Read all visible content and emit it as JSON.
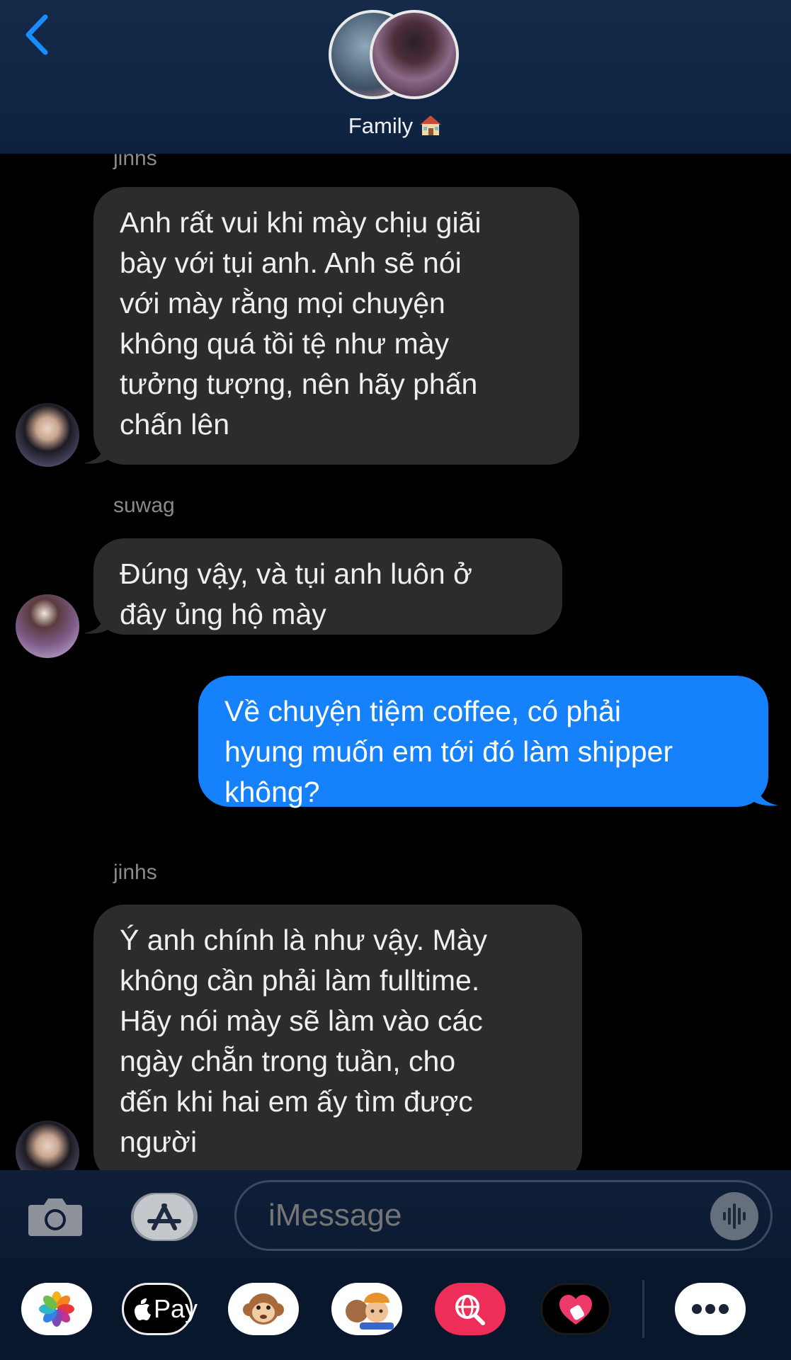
{
  "header": {
    "group_name": "Family",
    "back_icon": "chevron-left-icon",
    "accent_color": "#1a8cff"
  },
  "messages": [
    {
      "sender": "jinhs",
      "direction": "incoming",
      "lines": [
        "Anh rất vui khi mày chịu giãi",
        "bày với tụi anh. Anh sẽ nói",
        "với mày rằng mọi chuyện",
        "không quá tồi tệ như mày",
        "tưởng tượng, nên hãy phấn",
        "chấn lên"
      ]
    },
    {
      "sender": "suwag",
      "direction": "incoming",
      "lines": [
        "Đúng vậy, và tụi anh luôn ở",
        "đây ủng hộ mày"
      ]
    },
    {
      "sender": "",
      "direction": "outgoing",
      "lines": [
        "Về chuyện tiệm coffee, có phải",
        "hyung muốn em tới đó làm shipper",
        "không?"
      ]
    },
    {
      "sender": "jinhs",
      "direction": "incoming",
      "lines": [
        "Ý anh chính là như vậy. Mày",
        "không cần phải làm fulltime.",
        "Hãy nói mày sẽ làm vào các",
        "ngày chẵn trong tuần, cho",
        "đến khi hai em ấy tìm được",
        "người"
      ]
    }
  ],
  "composer": {
    "placeholder": "iMessage",
    "camera_icon": "camera-icon",
    "apps_icon": "app-store-icon",
    "audio_icon": "waveform-icon"
  },
  "app_drawer": {
    "apple_pay_label": "Pay",
    "apps": [
      "photos-icon",
      "apple-pay-icon",
      "animoji-icon",
      "memoji-icon",
      "web-search-icon",
      "digital-touch-icon",
      "more-icon"
    ]
  },
  "colors": {
    "incoming_bubble": "#2c2c2e",
    "outgoing_bubble": "#1581fb",
    "background": "#000000"
  }
}
